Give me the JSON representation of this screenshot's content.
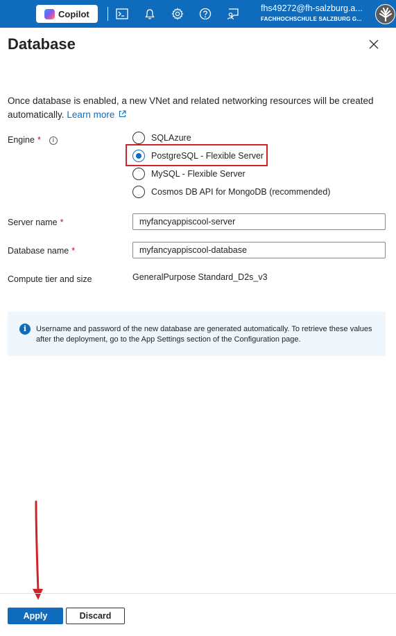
{
  "topbar": {
    "copilot_label": "Copilot",
    "icons": [
      "cloud-shell-icon",
      "bell-icon",
      "gear-icon",
      "help-icon",
      "feedback-icon"
    ],
    "account_email": "fhs49272@fh-salzburg.a...",
    "account_org": "FACHHOCHSCHULE SALZBURG G...",
    "color": "#0f6cbd"
  },
  "panel": {
    "title": "Database",
    "intro_text": "Once database is enabled, a new VNet and related networking resources will be created automatically.",
    "learn_more": "Learn more",
    "engine": {
      "label": "Engine",
      "required_mark": "*",
      "options": [
        {
          "label": "SQLAzure",
          "selected": false
        },
        {
          "label": "PostgreSQL - Flexible Server",
          "selected": true
        },
        {
          "label": "MySQL - Flexible Server",
          "selected": false
        },
        {
          "label": "Cosmos DB API for MongoDB (recommended)",
          "selected": false
        }
      ]
    },
    "server_name": {
      "label": "Server name",
      "required_mark": "*",
      "value": "myfancyappiscool-server"
    },
    "database_name": {
      "label": "Database name",
      "required_mark": "*",
      "value": "myfancyappiscool-database"
    },
    "compute": {
      "label": "Compute tier and size",
      "value": "GeneralPurpose Standard_D2s_v3"
    },
    "info_message": "Username and password of the new database are generated automatically. To retrieve these values after the deployment, go to the App Settings section of the Configuration page."
  },
  "footer": {
    "apply_label": "Apply",
    "discard_label": "Discard"
  },
  "colors": {
    "accent": "#0f6cbd",
    "highlight": "#d1232a",
    "info_bg": "#eff6fc"
  }
}
